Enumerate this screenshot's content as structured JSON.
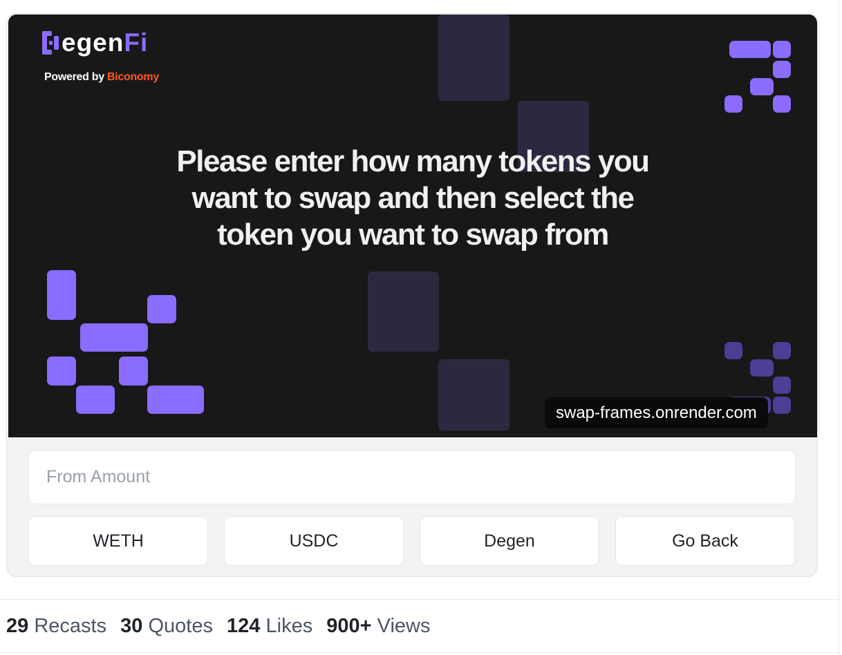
{
  "frame": {
    "logo": {
      "prefix": "D",
      "middle": "egen",
      "accent": "Fi"
    },
    "powered_by": {
      "text": "Powered by",
      "brand": "Biconomy"
    },
    "headline": "Please enter how many tokens you want to swap and then select the token you want to swap from",
    "domain": "swap-frames.onrender.com",
    "input": {
      "placeholder": "From Amount",
      "value": ""
    },
    "buttons": [
      "WETH",
      "USDC",
      "Degen",
      "Go Back"
    ],
    "colors": {
      "accent": "#8a6cff",
      "brand": "#ff5a1f",
      "background": "#181818"
    }
  },
  "stats": [
    {
      "count": "29",
      "label": "Recasts"
    },
    {
      "count": "30",
      "label": "Quotes"
    },
    {
      "count": "124",
      "label": "Likes"
    },
    {
      "count": "900+",
      "label": "Views"
    }
  ]
}
